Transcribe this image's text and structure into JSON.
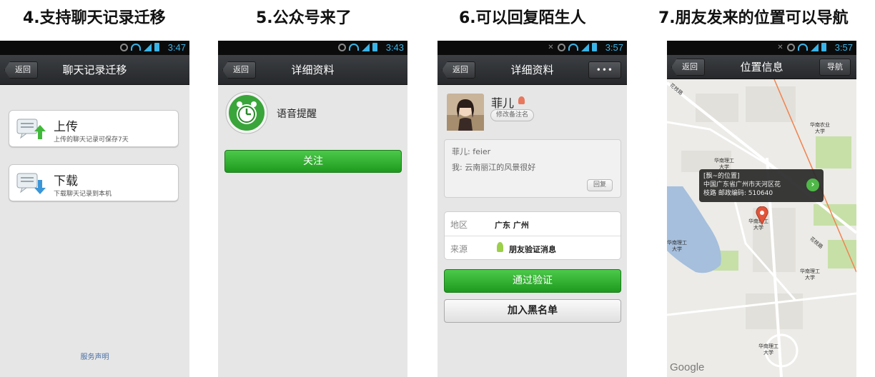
{
  "captions": [
    "4.支持聊天记录迁移",
    "5.公众号来了",
    "6.可以回复陌生人",
    "7.朋友发来的位置可以导航"
  ],
  "status": {
    "times": [
      "3:47",
      "3:43",
      "3:57",
      "3:57"
    ]
  },
  "s4": {
    "back": "返回",
    "title": "聊天记录迁移",
    "upload_title": "上传",
    "upload_sub": "上传的聊天记录可保存7天",
    "download_title": "下载",
    "download_sub": "下载聊天记录到本机",
    "footer": "服务声明"
  },
  "s5": {
    "back": "返回",
    "title": "详细资料",
    "account_name": "语音提醒",
    "follow": "关注"
  },
  "s6": {
    "back": "返回",
    "title": "详细资料",
    "more": "•••",
    "name": "菲儿",
    "edit_remark": "修改备注名",
    "msg1": "菲儿: feier",
    "msg2": "我: 云南丽江的风景很好",
    "reply": "回复",
    "region_label": "地区",
    "region_value": "广东  广州",
    "source_label": "来源",
    "source_value": "朋友验证消息",
    "verify": "通过验证",
    "blacklist": "加入黑名单"
  },
  "s7": {
    "back": "返回",
    "title": "位置信息",
    "navigate": "导航",
    "popup_line1": "[飘~的位置]",
    "popup_line2": "中国广东省广州市天河区花",
    "popup_line3": "枝路 邮政编码: 510640",
    "labels": [
      "华南农业\n大学",
      "华南理工\n大学",
      "华南理工\n大学",
      "华南理工\n大学",
      "华南理工\n大学",
      "华南理工\n大学",
      "花枝路",
      "花枝路"
    ],
    "google": "Google"
  },
  "colors": {
    "accent_green": "#2aa52a",
    "status_blue": "#39b4e8",
    "nav_dark": "#2f3235",
    "pin_red": "#e2553a"
  }
}
